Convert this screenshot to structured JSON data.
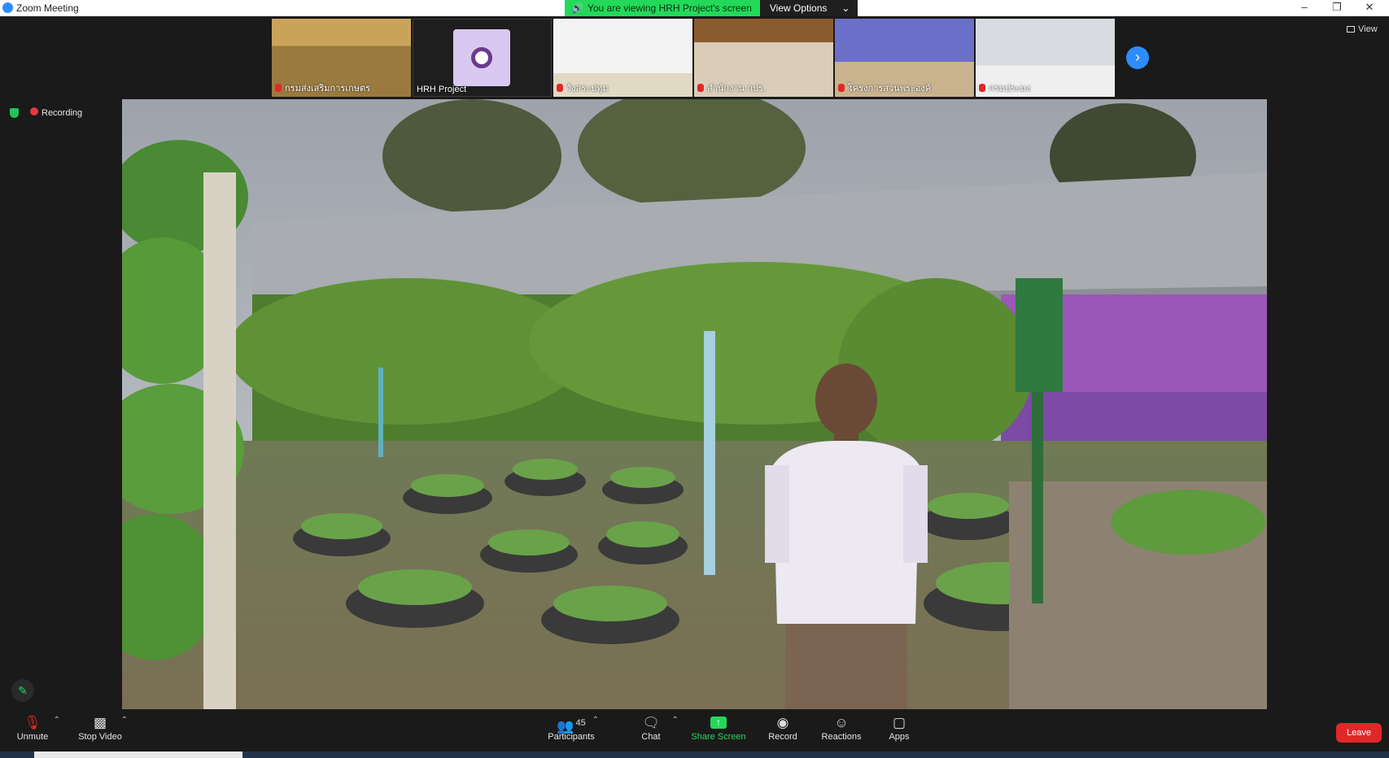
{
  "window": {
    "title": "Zoom Meeting"
  },
  "share_banner": {
    "viewing_text": "You are viewing HRH Project's screen",
    "options_label": "View Options"
  },
  "thumbnails": [
    {
      "name": "กรมส่งเสริมการเกษตร"
    },
    {
      "name": "HRH Project"
    },
    {
      "name": "วังสระปทุม"
    },
    {
      "name": "สำนักงาน กปร."
    },
    {
      "name": "โครงการสวนพระองค์"
    },
    {
      "name": "กรมประมง"
    }
  ],
  "view_button": {
    "label": "View"
  },
  "status": {
    "recording_label": "Recording"
  },
  "toolbar": {
    "unmute": "Unmute",
    "stop_video": "Stop Video",
    "participants": "Participants",
    "participants_count": "45",
    "chat": "Chat",
    "share_screen": "Share Screen",
    "record": "Record",
    "reactions": "Reactions",
    "apps": "Apps",
    "leave": "Leave"
  },
  "colors": {
    "accent": "#2d8cff",
    "share_green": "#23d959",
    "leave_red": "#e02828"
  }
}
